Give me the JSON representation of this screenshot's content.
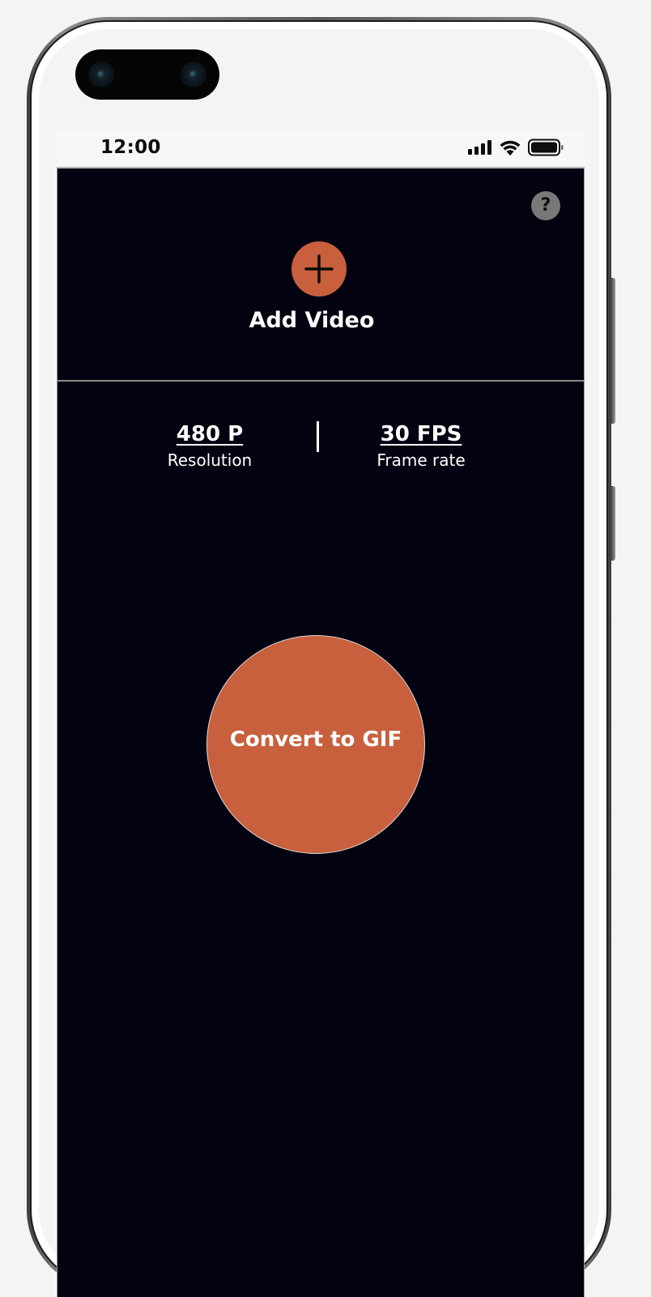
{
  "status_bar": {
    "time": "12:00"
  },
  "header": {
    "help_icon": "question-mark-icon",
    "help_glyph": "?",
    "add_video_icon": "plus-icon",
    "add_video_label": "Add Video"
  },
  "settings": {
    "resolution": {
      "value": "480 P",
      "label": "Resolution"
    },
    "frame_rate": {
      "value": "30 FPS",
      "label": "Frame rate"
    }
  },
  "main": {
    "convert_label": "Convert to GIF"
  },
  "colors": {
    "background": "#020211",
    "accent": "#c8603d",
    "help_icon_bg": "#7a7777",
    "text": "#ffffff"
  }
}
